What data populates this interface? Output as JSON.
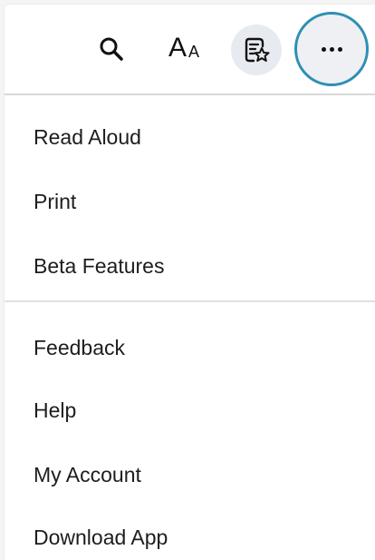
{
  "toolbar": {
    "buttons": [
      {
        "icon": "search-icon"
      },
      {
        "icon": "text-size-icon",
        "big": "A",
        "small": "A"
      },
      {
        "icon": "reading-list-star-icon"
      },
      {
        "icon": "more-options-icon"
      }
    ],
    "highlight_color": "#2e8fb3"
  },
  "menu": {
    "groups": [
      {
        "items": [
          {
            "label": "Read Aloud"
          },
          {
            "label": "Print"
          },
          {
            "label": "Beta Features"
          }
        ]
      },
      {
        "items": [
          {
            "label": "Feedback"
          },
          {
            "label": "Help"
          },
          {
            "label": "My Account"
          },
          {
            "label": "Download App"
          }
        ]
      }
    ]
  }
}
